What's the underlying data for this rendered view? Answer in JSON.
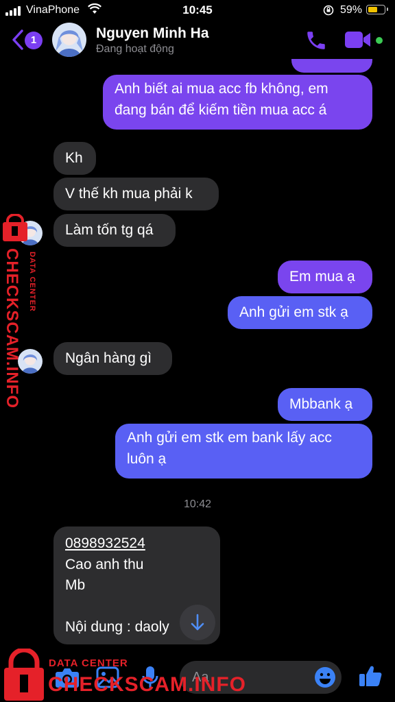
{
  "status_bar": {
    "carrier": "VinaPhone",
    "time": "10:45",
    "battery_percent": "59%",
    "battery_level": 0.59
  },
  "header": {
    "back_badge": "1",
    "contact_name": "Nguyen Minh Ha",
    "contact_status": "Đang hoạt động",
    "online": true
  },
  "messages": {
    "m1": {
      "dir": "out",
      "lines": [
        "Anh biết ai mua acc fb không, em",
        "đang bán để kiếm tiền mua acc á"
      ]
    },
    "m2": {
      "dir": "in",
      "text": "Kh"
    },
    "m3": {
      "dir": "in",
      "text": "V thế kh mua phải k"
    },
    "m4": {
      "dir": "in",
      "text": "Làm tốn tg qá"
    },
    "m5": {
      "dir": "out",
      "text": "Em mua ạ"
    },
    "m6": {
      "dir": "out",
      "text": "Anh gửi em stk ạ"
    },
    "m7": {
      "dir": "in",
      "text": "Ngân hàng gì"
    },
    "m8": {
      "dir": "out",
      "text": "Mbbank ạ"
    },
    "m9": {
      "dir": "out",
      "lines": [
        "Anh gửi em stk em bank lấy acc",
        "luôn ạ"
      ]
    },
    "timestamp": "10:42",
    "m10": {
      "dir": "in",
      "phone": "0898932524",
      "line2": "Cao anh thu",
      "line3": "Mb",
      "line5": "Nội dung : daoly"
    }
  },
  "composer": {
    "placeholder": "Aa"
  },
  "watermark": {
    "side_small": "DATA CENTER",
    "side_big": "CHECKSCAM.INFO",
    "bottom_small": "DATA CENTER",
    "bottom_big": "CHECKSCAM.INFO"
  },
  "colors": {
    "outgoing_bubble": "#7a45ee",
    "outgoing_bubble_blue": "#5960f4",
    "incoming_bubble": "#2d2d2f",
    "accent": "#7b3ff2",
    "watermark_red": "#e52129",
    "composer_blue": "#3b82f6"
  },
  "icons": {
    "back": "chevron-left-icon",
    "call": "phone-icon",
    "video": "video-camera-icon",
    "camera": "camera-icon",
    "gallery": "image-icon",
    "mic": "microphone-icon",
    "emoji": "smiley-icon",
    "like": "thumbs-up-icon",
    "scroll": "arrow-down-icon"
  }
}
